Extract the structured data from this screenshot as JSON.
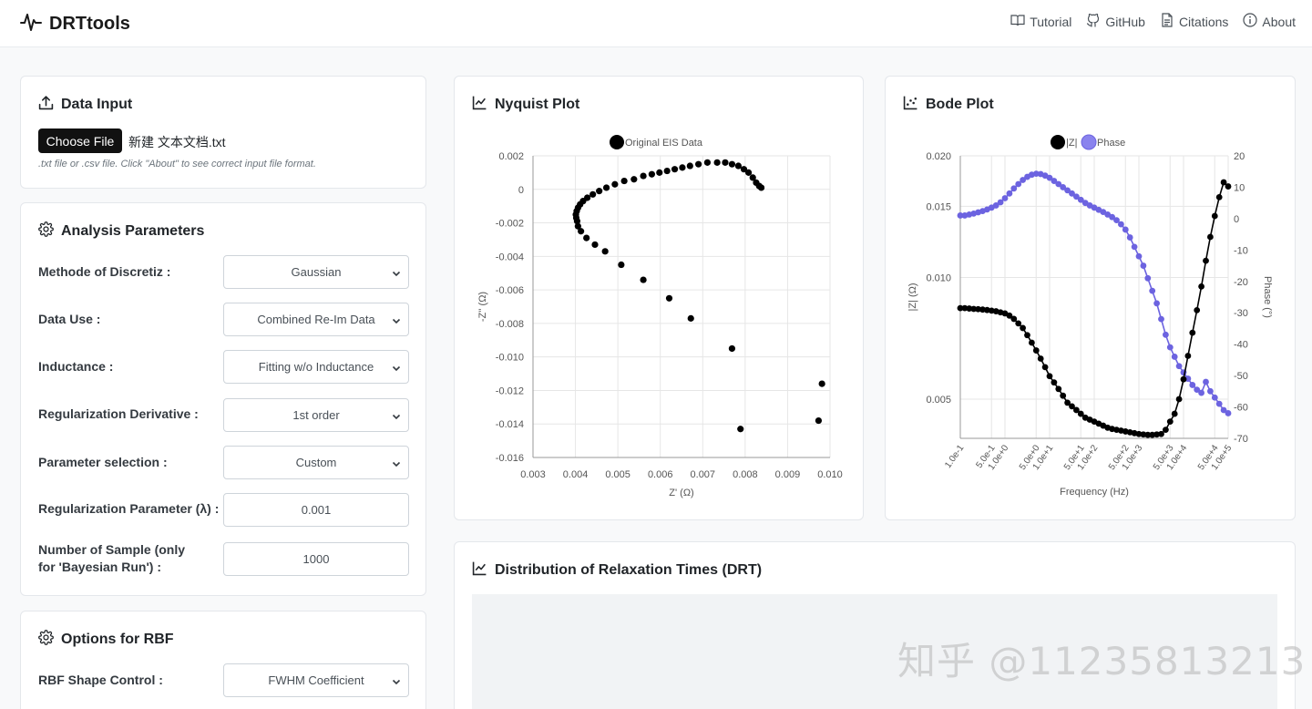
{
  "app": {
    "name": "DRTtools"
  },
  "nav": [
    {
      "label": "Tutorial",
      "icon": "book-icon"
    },
    {
      "label": "GitHub",
      "icon": "github-icon"
    },
    {
      "label": "Citations",
      "icon": "document-icon"
    },
    {
      "label": "About",
      "icon": "info-icon"
    }
  ],
  "data_input": {
    "title": "Data Input",
    "choose_file_label": "Choose File",
    "file_name": "新建 文本文档.txt",
    "hint": ".txt file or .csv file. Click \"About\" to see correct input file format."
  },
  "analysis": {
    "title": "Analysis Parameters",
    "params": [
      {
        "label": "Methode of Discretiz :",
        "value": "Gaussian",
        "kind": "select"
      },
      {
        "label": "Data Use :",
        "value": "Combined Re-Im Data",
        "kind": "select"
      },
      {
        "label": "Inductance :",
        "value": "Fitting w/o Inductance",
        "kind": "select"
      },
      {
        "label": "Regularization Derivative :",
        "value": "1st order",
        "kind": "select"
      },
      {
        "label": "Parameter selection :",
        "value": "Custom",
        "kind": "select"
      },
      {
        "label": "Regularization Parameter (λ) :",
        "value": "0.001",
        "kind": "input"
      },
      {
        "label": "Number of Sample (only for 'Bayesian Run') :",
        "value": "1000",
        "kind": "input"
      }
    ]
  },
  "rbf": {
    "title": "Options for RBF",
    "params": [
      {
        "label": "RBF Shape Control :",
        "value": "FWHM Coefficient",
        "kind": "select"
      }
    ]
  },
  "nyquist": {
    "title": "Nyquist Plot"
  },
  "bode": {
    "title": "Bode Plot"
  },
  "drt": {
    "title": "Distribution of Relaxation Times (DRT)"
  },
  "watermark": "知乎 @11235813213",
  "colors": {
    "phase": "#6c63e0",
    "magnitude": "#000000",
    "grid": "#e6e6e6"
  },
  "chart_data": [
    {
      "type": "scatter",
      "title": "Nyquist Plot",
      "xlabel": "Z' (Ω)",
      "ylabel": "-Z'' (Ω)",
      "xlim": [
        0.003,
        0.01
      ],
      "ylim": [
        -0.016,
        0.002
      ],
      "x_ticks": [
        "0.003",
        "0.004",
        "0.005",
        "0.006",
        "0.007",
        "0.008",
        "0.009",
        "0.010"
      ],
      "y_ticks": [
        "0.002",
        "0",
        "-0.002",
        "-0.004",
        "-0.006",
        "-0.008",
        "-0.010",
        "-0.012",
        "-0.014",
        "-0.016"
      ],
      "grid": true,
      "legend_position": "top",
      "series": [
        {
          "name": "Original EIS Data",
          "points": [
            [
              0.00838,
              0.0001
            ],
            [
              0.00833,
              0.0002
            ],
            [
              0.00826,
              0.0004
            ],
            [
              0.00818,
              0.0007
            ],
            [
              0.00808,
              0.001
            ],
            [
              0.00797,
              0.0012
            ],
            [
              0.00784,
              0.0014
            ],
            [
              0.00769,
              0.0015
            ],
            [
              0.00753,
              0.0016
            ],
            [
              0.00734,
              0.0016
            ],
            [
              0.00711,
              0.0016
            ],
            [
              0.0069,
              0.0015
            ],
            [
              0.0067,
              0.0014
            ],
            [
              0.00652,
              0.0013
            ],
            [
              0.00634,
              0.0012
            ],
            [
              0.00616,
              0.0011
            ],
            [
              0.00598,
              0.001
            ],
            [
              0.0058,
              0.0009
            ],
            [
              0.0056,
              0.0008
            ],
            [
              0.00538,
              0.0006
            ],
            [
              0.00515,
              0.0005
            ],
            [
              0.00493,
              0.0003
            ],
            [
              0.00473,
              0.0001
            ],
            [
              0.00456,
              -0.0001
            ],
            [
              0.00441,
              -0.0003
            ],
            [
              0.00428,
              -0.0005
            ],
            [
              0.00418,
              -0.0007
            ],
            [
              0.00411,
              -0.0009
            ],
            [
              0.00406,
              -0.0011
            ],
            [
              0.00403,
              -0.0013
            ],
            [
              0.00401,
              -0.0015
            ],
            [
              0.00402,
              -0.0017
            ],
            [
              0.00404,
              -0.0019
            ],
            [
              0.00406,
              -0.0022
            ],
            [
              0.00413,
              -0.0025
            ],
            [
              0.00426,
              -0.0029
            ],
            [
              0.00446,
              -0.0033
            ],
            [
              0.0047,
              -0.0037
            ],
            [
              0.00508,
              -0.0045
            ],
            [
              0.0056,
              -0.0054
            ],
            [
              0.00621,
              -0.0065
            ],
            [
              0.00672,
              -0.0077
            ],
            [
              0.00769,
              -0.0095
            ],
            [
              0.00789,
              -0.0143
            ],
            [
              0.00973,
              -0.0138
            ],
            [
              0.00981,
              -0.0116
            ]
          ]
        }
      ]
    },
    {
      "type": "line",
      "title": "Bode Plot",
      "xlabel": "Frequency (Hz)",
      "ylabel": "|Z| (Ω)",
      "y2label": "Phase (°)",
      "x_scale": "log",
      "xlim": [
        0.1,
        100000
      ],
      "ylim": [
        0.004,
        0.02
      ],
      "y2lim": [
        -70,
        20
      ],
      "x_ticks": [
        "1.0e-1",
        "5.0e-1",
        "1.0e+0",
        "5.0e+0",
        "1.0e+1",
        "5.0e+1",
        "1.0e+2",
        "5.0e+2",
        "1.0e+3",
        "5.0e+3",
        "1.0e+4",
        "5.0e+4",
        "1.0e+5"
      ],
      "y_ticks": [
        "0.020",
        "0.015",
        "0.010",
        "0.005"
      ],
      "y2_ticks": [
        "20",
        "10",
        "0",
        "-10",
        "-20",
        "-30",
        "-40",
        "-50",
        "-60",
        "-70"
      ],
      "grid": true,
      "legend_position": "top",
      "series": [
        {
          "name": "|Z|",
          "axis": "left",
          "logf": [
            -1.0,
            -0.9,
            -0.8,
            -0.7,
            -0.6,
            -0.5,
            -0.4,
            -0.3,
            -0.2,
            -0.1,
            0.0,
            0.1,
            0.2,
            0.3,
            0.4,
            0.5,
            0.6,
            0.7,
            0.8,
            0.9,
            1.0,
            1.1,
            1.2,
            1.3,
            1.4,
            1.5,
            1.6,
            1.7,
            1.8,
            1.9,
            2.0,
            2.1,
            2.2,
            2.3,
            2.4,
            2.5,
            2.6,
            2.7,
            2.8,
            2.9,
            3.0,
            3.1,
            3.2,
            3.3,
            3.4,
            3.5,
            3.6,
            3.7,
            3.8,
            3.9,
            4.0,
            4.1,
            4.2,
            4.3,
            4.4,
            4.5,
            4.6,
            4.7,
            4.8,
            4.9,
            5.0
          ],
          "values": [
            0.0084,
            0.0084,
            0.00838,
            0.00836,
            0.00835,
            0.00833,
            0.00831,
            0.00828,
            0.00825,
            0.0082,
            0.00815,
            0.00805,
            0.0079,
            0.0077,
            0.0075,
            0.0072,
            0.0069,
            0.0066,
            0.0063,
            0.006,
            0.0057,
            0.0055,
            0.0053,
            0.0051,
            0.0049,
            0.0048,
            0.0047,
            0.0046,
            0.0045,
            0.00445,
            0.0044,
            0.00435,
            0.0043,
            0.00425,
            0.00422,
            0.0042,
            0.00418,
            0.00416,
            0.00414,
            0.00412,
            0.0041,
            0.00409,
            0.00408,
            0.00408,
            0.00409,
            0.0041,
            0.0042,
            0.0044,
            0.0046,
            0.005,
            0.0056,
            0.0064,
            0.0073,
            0.0083,
            0.0095,
            0.011,
            0.0126,
            0.0142,
            0.0158,
            0.0172,
            0.0168
          ]
        },
        {
          "name": "Phase",
          "axis": "right",
          "logf": [
            -1.0,
            -0.9,
            -0.8,
            -0.7,
            -0.6,
            -0.5,
            -0.4,
            -0.3,
            -0.2,
            -0.1,
            0.0,
            0.1,
            0.2,
            0.3,
            0.4,
            0.5,
            0.6,
            0.7,
            0.8,
            0.9,
            1.0,
            1.1,
            1.2,
            1.3,
            1.4,
            1.5,
            1.6,
            1.7,
            1.8,
            1.9,
            2.0,
            2.1,
            2.2,
            2.3,
            2.4,
            2.5,
            2.6,
            2.7,
            2.8,
            2.9,
            3.0,
            3.1,
            3.2,
            3.3,
            3.4,
            3.5,
            3.6,
            3.7,
            3.8,
            3.9,
            4.0,
            4.1,
            4.2,
            4.3,
            4.4,
            4.5,
            4.6,
            4.7,
            4.8,
            4.9,
            5.0
          ],
          "values": [
            1.0,
            1.0,
            1.3,
            1.6,
            2.0,
            2.4,
            2.9,
            3.5,
            4.2,
            5.2,
            6.5,
            8.0,
            9.6,
            11.0,
            12.3,
            13.3,
            14.0,
            14.3,
            14.2,
            13.7,
            13.0,
            12.0,
            11.0,
            10.0,
            9.0,
            8.0,
            7.0,
            6.0,
            5.0,
            4.2,
            3.5,
            2.8,
            2.1,
            1.3,
            0.5,
            -0.5,
            -1.8,
            -3.5,
            -6.0,
            -9.0,
            -12.0,
            -15.0,
            -19.0,
            -23.0,
            -27.0,
            -32.0,
            -37.0,
            -41.0,
            -44.0,
            -47.0,
            -49.0,
            -51.0,
            -53.0,
            -54.5,
            -55.5,
            -52.0,
            -55.0,
            -57.0,
            -59.0,
            -61.0,
            -62.0
          ]
        }
      ]
    }
  ]
}
